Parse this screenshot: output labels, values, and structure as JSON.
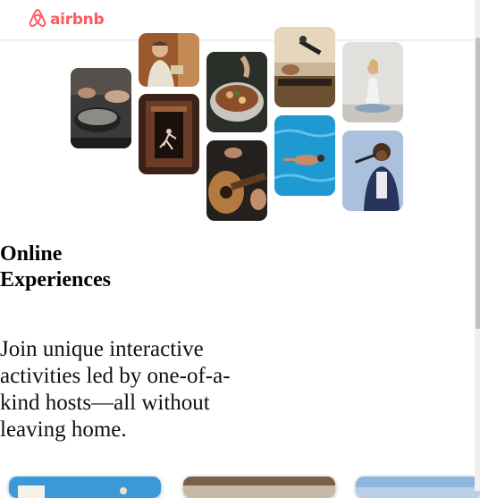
{
  "brand": {
    "name": "airbnb",
    "color": "#ff5a5f",
    "icon": "airbnb-logo-icon"
  },
  "hero": {
    "title": "Online Experiences",
    "description": "Join unique interactive activities led by one-of-a-kind hosts—all without leaving home."
  },
  "collage": [
    {
      "name": "cooking-pot-photo",
      "subject": "cooking"
    },
    {
      "name": "smiling-host-photo",
      "subject": "host"
    },
    {
      "name": "dancer-photo",
      "subject": "dance"
    },
    {
      "name": "food-bowl-photo",
      "subject": "food"
    },
    {
      "name": "guitar-photo",
      "subject": "guitar"
    },
    {
      "name": "microphone-photo",
      "subject": "music"
    },
    {
      "name": "swimmer-photo",
      "subject": "swimming"
    },
    {
      "name": "yoga-photo",
      "subject": "yoga"
    },
    {
      "name": "singer-photo",
      "subject": "singing"
    }
  ],
  "cards": [
    {
      "name": "experience-card-1"
    },
    {
      "name": "experience-card-2"
    },
    {
      "name": "experience-card-3"
    }
  ]
}
